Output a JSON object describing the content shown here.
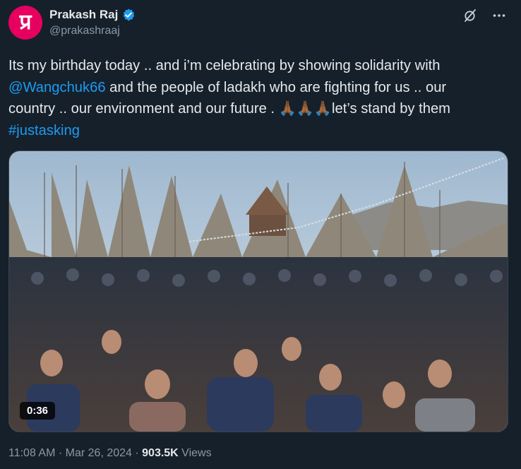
{
  "author": {
    "avatar_text": "प्र",
    "display_name": "Prakash Raj",
    "handle": "@prakashraaj",
    "verified": true
  },
  "tweet": {
    "line1": "Its my birthday today .. and i’m celebrating by showing solidarity with",
    "mention": "@Wangchuk66",
    "line2_rest": " and the people of ladakh who are fighting for us .. our",
    "line3": "country .. our environment and our future . 🙏🏾🙏🏾🙏🏾let’s stand by them",
    "hashtag": "#justasking"
  },
  "media": {
    "type": "video",
    "duration": "0:36"
  },
  "meta": {
    "time": "11:08 AM",
    "separator": " · ",
    "date": "Mar 26, 2024",
    "views_count": "903.5K",
    "views_label": " Views"
  },
  "icons": [
    "verified-badge-icon",
    "grok-icon",
    "more-icon"
  ],
  "colors": {
    "background": "#15202b",
    "text": "#e7e9ea",
    "secondary": "#8b98a5",
    "link": "#1d9bf0",
    "avatar": "#e60060"
  }
}
